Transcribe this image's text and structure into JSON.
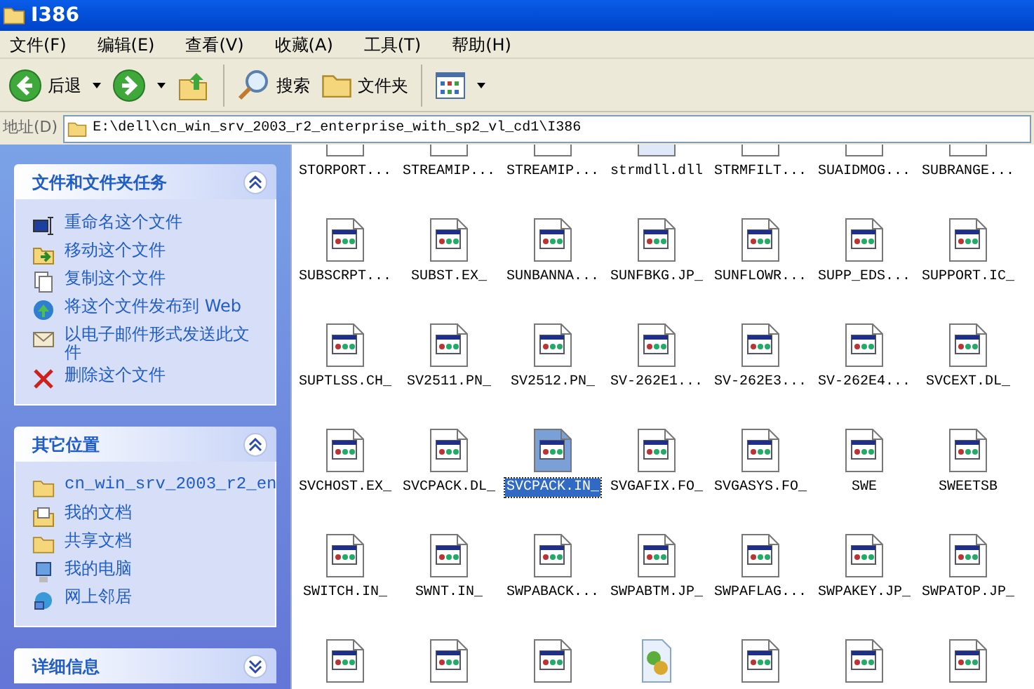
{
  "window": {
    "title": "I386"
  },
  "menu": [
    {
      "label": "文件(F)"
    },
    {
      "label": "编辑(E)"
    },
    {
      "label": "查看(V)"
    },
    {
      "label": "收藏(A)"
    },
    {
      "label": "工具(T)"
    },
    {
      "label": "帮助(H)"
    }
  ],
  "toolbar": [
    {
      "kind": "back",
      "label": "后退",
      "dropdown": true
    },
    {
      "kind": "forward",
      "dropdown": true
    },
    {
      "kind": "up"
    },
    {
      "kind": "separator"
    },
    {
      "kind": "search",
      "label": "搜索"
    },
    {
      "kind": "folders",
      "label": "文件夹"
    },
    {
      "kind": "separator"
    },
    {
      "kind": "views",
      "dropdown": true
    }
  ],
  "address": {
    "label": "地址(D)",
    "path": "E:\\dell\\cn_win_srv_2003_r2_enterprise_with_sp2_vl_cd1\\I386"
  },
  "panels": [
    {
      "title": "文件和文件夹任务",
      "expanded": true,
      "items": [
        {
          "kind": "rename",
          "label": "重命名这个文件"
        },
        {
          "kind": "move",
          "label": "移动这个文件"
        },
        {
          "kind": "copy",
          "label": "复制这个文件"
        },
        {
          "kind": "web",
          "label": "将这个文件发布到 Web"
        },
        {
          "kind": "mail",
          "label": "以电子邮件形式发送此文件"
        },
        {
          "kind": "delete",
          "label": "删除这个文件"
        }
      ]
    },
    {
      "title": "其它位置",
      "expanded": true,
      "items": [
        {
          "kind": "folder",
          "label": "cn_win_srv_2003_r2_en"
        },
        {
          "kind": "docs",
          "label": "我的文档"
        },
        {
          "kind": "folder",
          "label": "共享文档"
        },
        {
          "kind": "computer",
          "label": "我的电脑"
        },
        {
          "kind": "network",
          "label": "网上邻居"
        }
      ]
    },
    {
      "title": "详细信息",
      "expanded": false
    }
  ],
  "files": [
    {
      "label": "STORPORT...",
      "kind": "app",
      "selected": false
    },
    {
      "label": "STREAMIP...",
      "kind": "app",
      "selected": false
    },
    {
      "label": "STREAMIP...",
      "kind": "app",
      "selected": false
    },
    {
      "label": "strmdll.dll",
      "kind": "dll",
      "selected": false
    },
    {
      "label": "STRMFILT...",
      "kind": "app",
      "selected": false
    },
    {
      "label": "SUAIDMOG...",
      "kind": "app",
      "selected": false
    },
    {
      "label": "SUBRANGE...",
      "kind": "app",
      "selected": false
    },
    {
      "label": "SUBSCRPT...",
      "kind": "app",
      "selected": false
    },
    {
      "label": "SUBST.EX_",
      "kind": "app",
      "selected": false
    },
    {
      "label": "SUNBANNA...",
      "kind": "app",
      "selected": false
    },
    {
      "label": "SUNFBKG.JP_",
      "kind": "app",
      "selected": false
    },
    {
      "label": "SUNFLOWR...",
      "kind": "app",
      "selected": false
    },
    {
      "label": "SUPP_EDS...",
      "kind": "app",
      "selected": false
    },
    {
      "label": "SUPPORT.IC_",
      "kind": "app",
      "selected": false
    },
    {
      "label": "SUPTLSS.CH_",
      "kind": "app",
      "selected": false
    },
    {
      "label": "SV2511.PN_",
      "kind": "app",
      "selected": false
    },
    {
      "label": "SV2512.PN_",
      "kind": "app",
      "selected": false
    },
    {
      "label": "SV-262E1...",
      "kind": "app",
      "selected": false
    },
    {
      "label": "SV-262E3...",
      "kind": "app",
      "selected": false
    },
    {
      "label": "SV-262E4...",
      "kind": "app",
      "selected": false
    },
    {
      "label": "SVCEXT.DL_",
      "kind": "app",
      "selected": false
    },
    {
      "label": "SVCHOST.EX_",
      "kind": "app",
      "selected": false
    },
    {
      "label": "SVCPACK.DL_",
      "kind": "app",
      "selected": false
    },
    {
      "label": "SVCPACK.IN_",
      "kind": "app",
      "selected": true
    },
    {
      "label": "SVGAFIX.FO_",
      "kind": "app",
      "selected": false
    },
    {
      "label": "SVGASYS.FO_",
      "kind": "app",
      "selected": false
    },
    {
      "label": "SWE",
      "kind": "app",
      "selected": false
    },
    {
      "label": "SWEETSB",
      "kind": "app",
      "selected": false
    },
    {
      "label": "SWITCH.IN_",
      "kind": "app",
      "selected": false
    },
    {
      "label": "SWNT.IN_",
      "kind": "app",
      "selected": false
    },
    {
      "label": "SWPABACK...",
      "kind": "app",
      "selected": false
    },
    {
      "label": "SWPABTM.JP_",
      "kind": "app",
      "selected": false
    },
    {
      "label": "SWPAFLAG...",
      "kind": "app",
      "selected": false
    },
    {
      "label": "SWPAKEY.JP_",
      "kind": "app",
      "selected": false
    },
    {
      "label": "SWPATOP.JP_",
      "kind": "app",
      "selected": false
    },
    {
      "kind": "app",
      "selected": false
    },
    {
      "kind": "app",
      "selected": false
    },
    {
      "kind": "app",
      "selected": false
    },
    {
      "kind": "setup",
      "selected": false
    },
    {
      "kind": "app",
      "selected": false
    },
    {
      "kind": "app",
      "selected": false
    },
    {
      "kind": "app",
      "selected": false
    }
  ]
}
